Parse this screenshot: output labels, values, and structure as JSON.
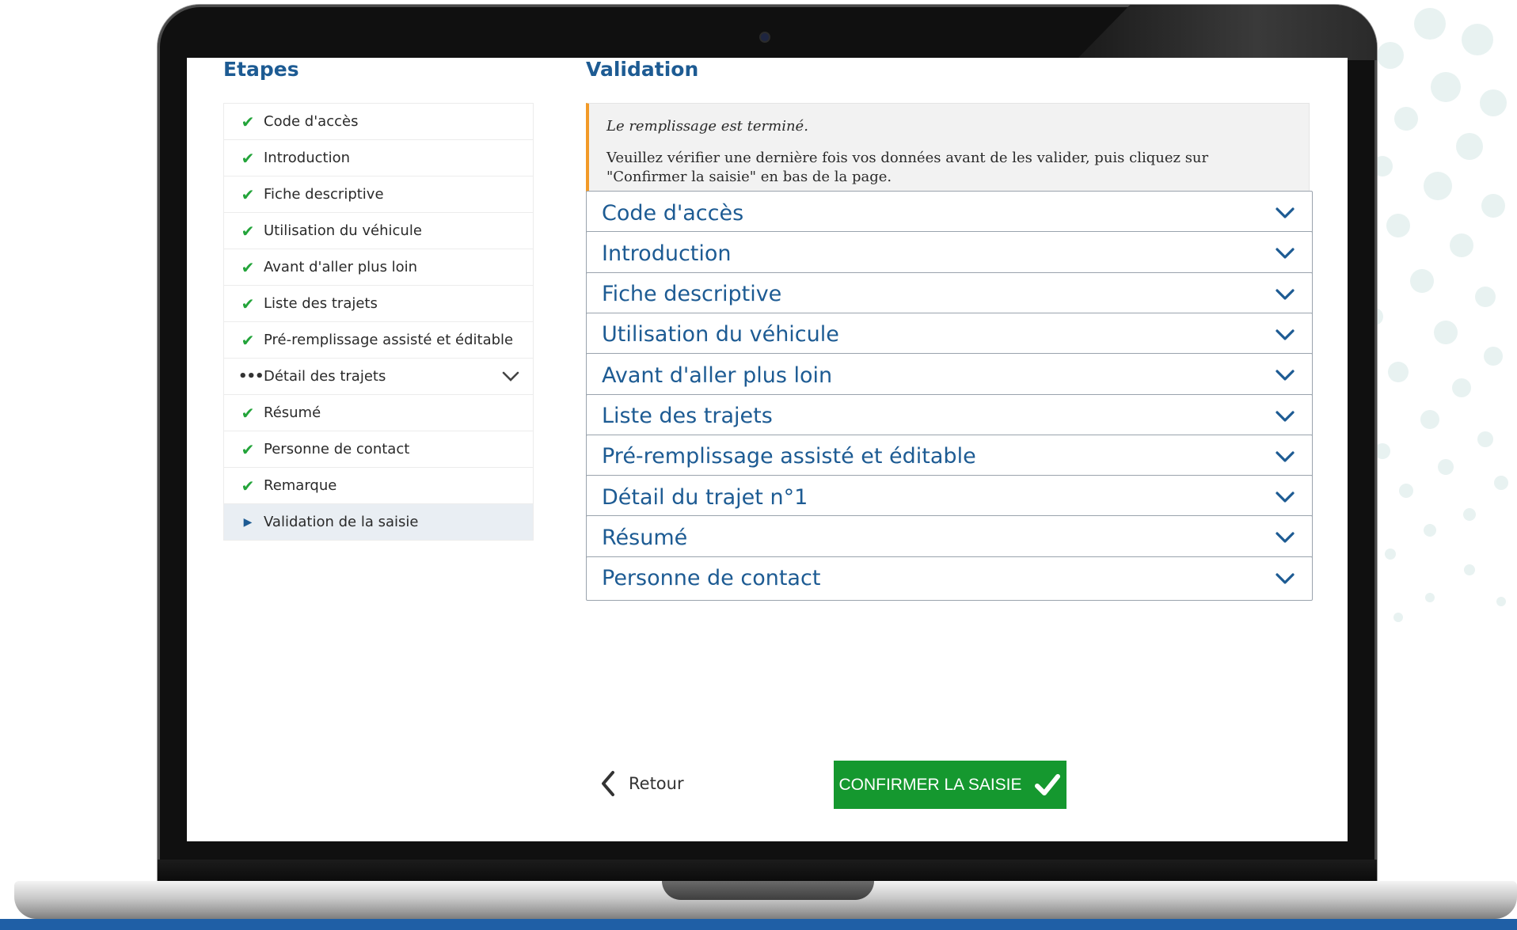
{
  "sidebar": {
    "title": "Etapes",
    "steps": [
      {
        "label": "Code d'accès",
        "status": "done"
      },
      {
        "label": "Introduction",
        "status": "done"
      },
      {
        "label": "Fiche descriptive",
        "status": "done"
      },
      {
        "label": "Utilisation du véhicule",
        "status": "done"
      },
      {
        "label": "Avant d'aller plus loin",
        "status": "done"
      },
      {
        "label": "Liste des trajets",
        "status": "done"
      },
      {
        "label": "Pré-remplissage assisté et éditable",
        "status": "done"
      },
      {
        "label": "Détail des trajets",
        "status": "in-progress"
      },
      {
        "label": "Résumé",
        "status": "done"
      },
      {
        "label": "Personne de contact",
        "status": "done"
      },
      {
        "label": "Remarque",
        "status": "done"
      },
      {
        "label": "Validation de la saisie",
        "status": "current"
      }
    ]
  },
  "main": {
    "title": "Validation",
    "notice": {
      "heading": "Le remplissage est terminé.",
      "message": "Veuillez vérifier une dernière fois vos données avant de les valider, puis cliquez sur \"Confirmer la saisie\" en bas de la page."
    },
    "sections": [
      {
        "label": "Code d'accès"
      },
      {
        "label": "Introduction"
      },
      {
        "label": "Fiche descriptive"
      },
      {
        "label": "Utilisation du véhicule"
      },
      {
        "label": "Avant d'aller plus loin"
      },
      {
        "label": "Liste des trajets"
      },
      {
        "label": "Pré-remplissage assisté et éditable"
      },
      {
        "label": "Détail du trajet n°1"
      },
      {
        "label": "Résumé"
      },
      {
        "label": "Personne de contact"
      }
    ]
  },
  "actions": {
    "back_label": "Retour",
    "confirm_label": "CONFIRMER LA SAISIE"
  },
  "colors": {
    "primary_blue": "#1d5b93",
    "check_green": "#23a43a",
    "confirm_green": "#15982f",
    "notice_accent": "#f29a28"
  },
  "icons": {
    "done": "check-icon",
    "in-progress": "dots-icon",
    "current": "caret-right-icon",
    "expand": "chevron-down-icon",
    "back": "chevron-left-icon"
  }
}
